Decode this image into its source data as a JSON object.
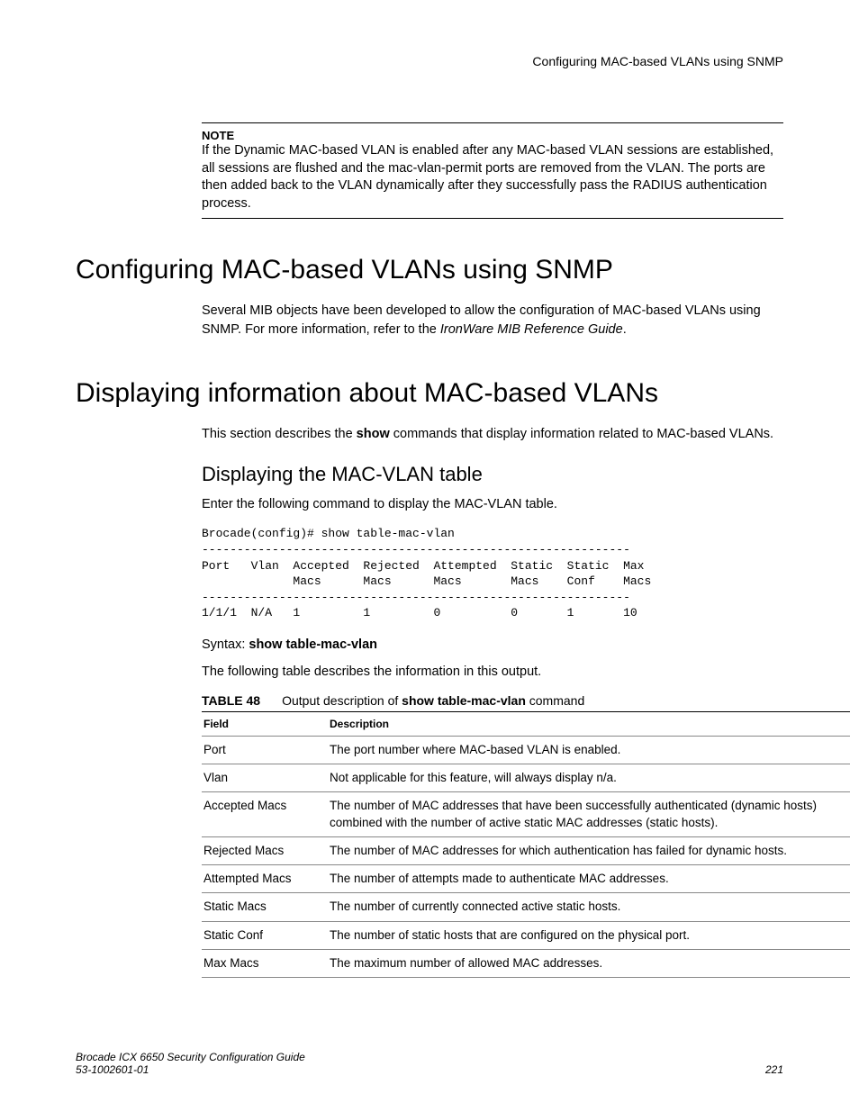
{
  "running_header": "Configuring MAC-based VLANs using SNMP",
  "note": {
    "label": "NOTE",
    "body": "If the Dynamic MAC-based VLAN is enabled after any MAC-based VLAN sessions are established, all sessions are flushed and the mac-vlan-permit ports are removed from the VLAN. The ports are then added back to the VLAN dynamically after they successfully pass the RADIUS authentication process."
  },
  "section1": {
    "title": "Configuring MAC-based VLANs using SNMP",
    "para_pre": "Several MIB objects have been developed to allow the configuration of MAC-based VLANs using SNMP. For more information, refer to the ",
    "para_ital": "IronWare MIB Reference Guide",
    "para_post": "."
  },
  "section2": {
    "title": "Displaying information about MAC-based VLANs",
    "intro_pre": "This section describes the ",
    "intro_bold": "show",
    "intro_post": " commands that display information related to MAC-based VLANs.",
    "sub1": {
      "title": "Displaying the MAC-VLAN table",
      "lead": "Enter the following command to display the MAC-VLAN table.",
      "cli": "Brocade(config)# show table-mac-vlan\n-------------------------------------------------------------\nPort   Vlan  Accepted  Rejected  Attempted  Static  Static  Max\n             Macs      Macs      Macs       Macs    Conf    Macs\n-------------------------------------------------------------\n1/1/1  N/A   1         1         0          0       1       10",
      "syntax_label": "Syntax:  ",
      "syntax_cmd": "show table-mac-vlan",
      "followup": "The following table describes the information in this output.",
      "table_caption_num": "TABLE 48",
      "table_caption_pre": "Output description of ",
      "table_caption_bold": "show table-mac-vlan",
      "table_caption_post": " command",
      "table_headers": {
        "field": "Field",
        "desc": "Description"
      },
      "rows": [
        {
          "field": "Port",
          "desc": "The port number where MAC-based VLAN is enabled."
        },
        {
          "field": "Vlan",
          "desc": "Not applicable for this feature, will always display n/a."
        },
        {
          "field": "Accepted Macs",
          "desc": "The number of MAC addresses that have been successfully authenticated (dynamic hosts) combined with the number of active static MAC addresses (static hosts)."
        },
        {
          "field": "Rejected Macs",
          "desc": "The number of MAC addresses for which authentication has failed for dynamic hosts."
        },
        {
          "field": "Attempted Macs",
          "desc": "The number of attempts made to authenticate MAC addresses."
        },
        {
          "field": "Static Macs",
          "desc": "The number of currently connected active static hosts."
        },
        {
          "field": "Static Conf",
          "desc": "The number of static hosts that are configured on the physical port."
        },
        {
          "field": "Max Macs",
          "desc": "The maximum number of allowed MAC addresses."
        }
      ]
    }
  },
  "footer": {
    "line1": "Brocade ICX 6650 Security Configuration Guide",
    "line2": "53-1002601-01",
    "page": "221"
  }
}
